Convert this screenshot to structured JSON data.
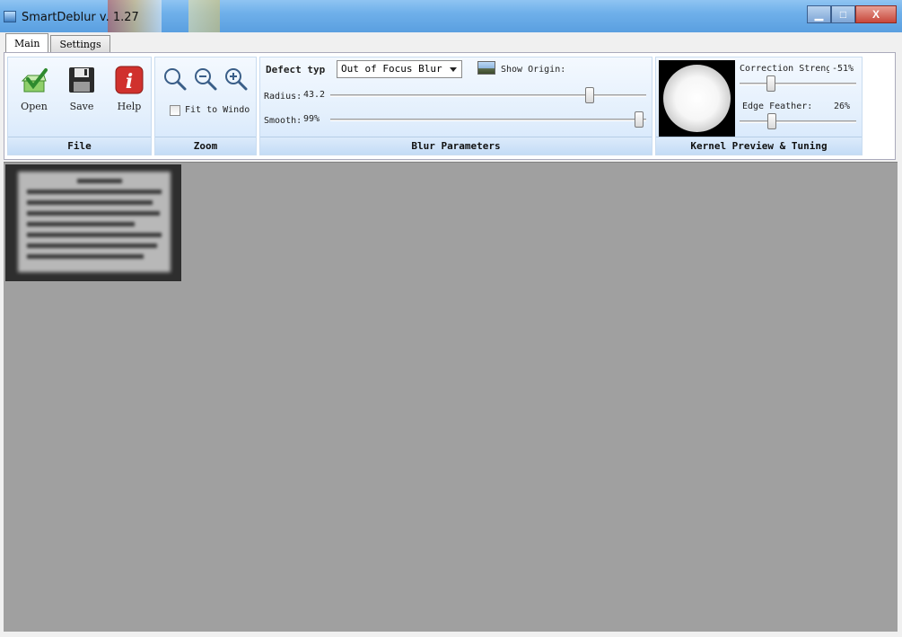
{
  "window": {
    "title": "SmartDeblur v. 1.27"
  },
  "title_buttons": {
    "minimize": "▁",
    "maximize": "□",
    "close": "X"
  },
  "tabs": [
    {
      "label": "Main",
      "active": true
    },
    {
      "label": "Settings",
      "active": false
    }
  ],
  "file_group": {
    "label": "File",
    "open": "Open",
    "save": "Save",
    "help": "Help"
  },
  "zoom_group": {
    "label": "Zoom",
    "fit_to_window": "Fit to Windo",
    "fit_checked": false
  },
  "blur_group": {
    "label": "Blur Parameters",
    "defect_label": "Defect typ",
    "defect_value": "Out of Focus Blur",
    "show_original": "Show Origin:",
    "radius_label": "Radius:",
    "radius_value": "43.2",
    "radius_level": 0.83,
    "smooth_label": "Smooth:",
    "smooth_value": "99%",
    "smooth_level": 0.99
  },
  "kernel_group": {
    "label": "Kernel Preview & Tuning",
    "correction_label": "Correction Streng",
    "correction_value": "-51%",
    "correction_level": 0.25,
    "feather_label": "Edge Feather:",
    "feather_value": "26%",
    "feather_level": 0.26
  },
  "colors": {
    "titlebar": "#6fb0ea",
    "canvas": "#a0a0a0",
    "group_fill": "#e3effc",
    "help_icon": "#d0312d",
    "open_icon": "#4fa83a"
  }
}
